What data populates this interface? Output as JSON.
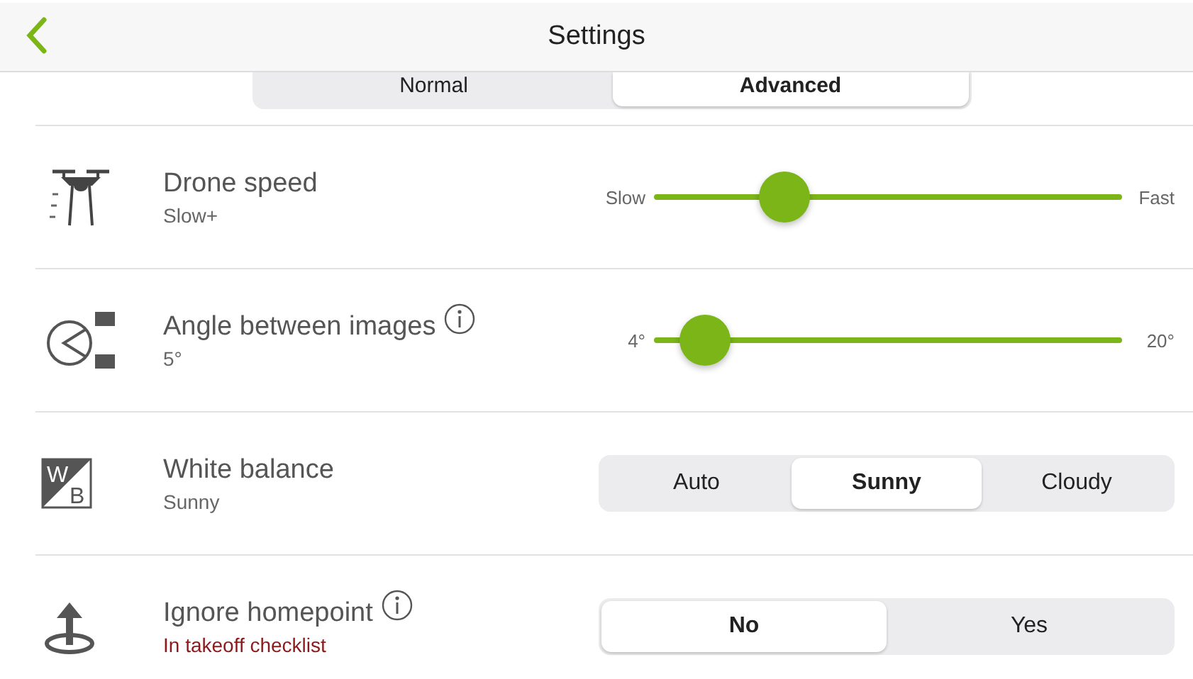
{
  "header": {
    "title": "Settings"
  },
  "mode_tabs": [
    {
      "label": "Normal",
      "selected": false
    },
    {
      "label": "Advanced",
      "selected": true
    }
  ],
  "settings": [
    {
      "kind": "slider",
      "title": "Drone speed",
      "subtitle": "Slow+",
      "alert": false,
      "info": false,
      "min_label": "Slow",
      "max_label": "Fast",
      "level": 0.28
    },
    {
      "kind": "slider",
      "title": "Angle between images",
      "subtitle": "5°",
      "alert": false,
      "info": true,
      "min_label": "4°",
      "max_label": "20°",
      "level": 0.11
    },
    {
      "kind": "segmented",
      "icon_letters": [
        "W",
        "B"
      ],
      "title": "White balance",
      "subtitle": "Sunny",
      "alert": false,
      "info": false,
      "options": [
        {
          "label": "Auto",
          "selected": false
        },
        {
          "label": "Sunny",
          "selected": true
        },
        {
          "label": "Cloudy",
          "selected": false
        }
      ]
    },
    {
      "kind": "segmented",
      "title": "Ignore homepoint",
      "subtitle": "In takeoff checklist",
      "alert": true,
      "info": true,
      "options": [
        {
          "label": "No",
          "selected": true
        },
        {
          "label": "Yes",
          "selected": false
        }
      ]
    }
  ]
}
